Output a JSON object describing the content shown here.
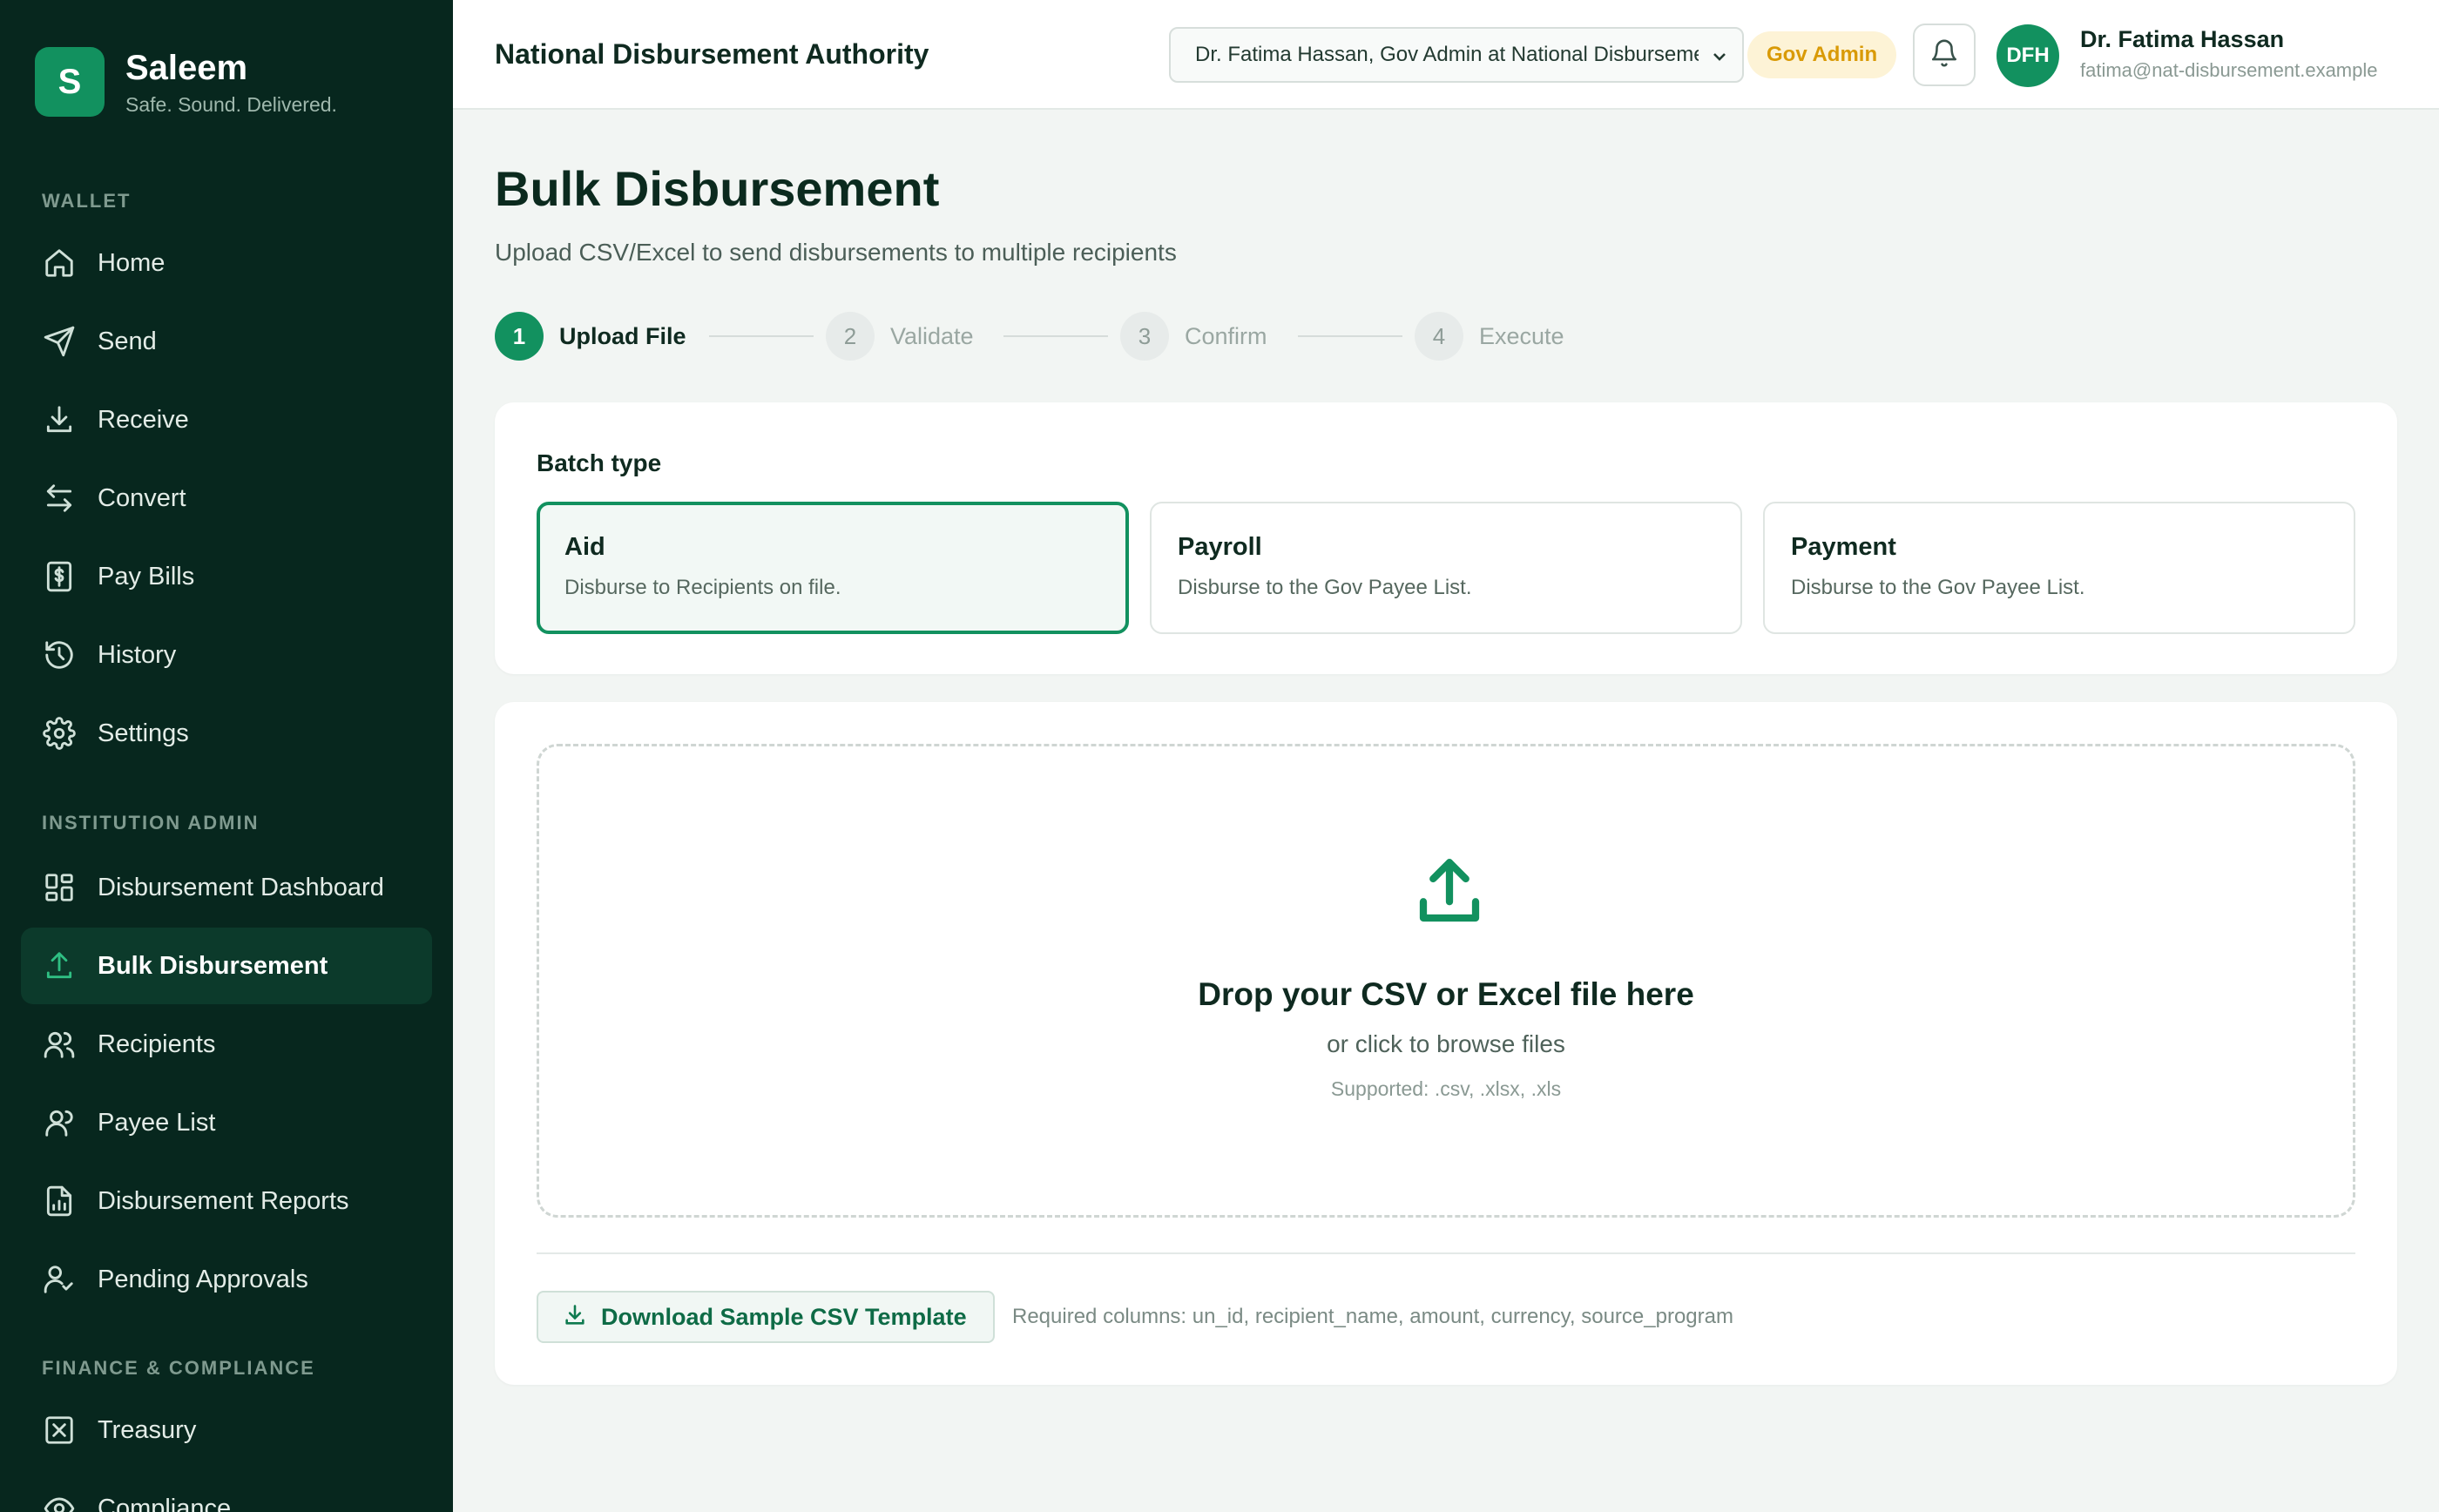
{
  "brand": {
    "initial": "S",
    "name": "Saleem",
    "tagline": "Safe. Sound. Delivered."
  },
  "sidebar": {
    "sections": [
      {
        "label": "WALLET",
        "items": [
          {
            "label": "Home",
            "icon": "home-icon"
          },
          {
            "label": "Send",
            "icon": "send-icon"
          },
          {
            "label": "Receive",
            "icon": "receive-icon"
          },
          {
            "label": "Convert",
            "icon": "convert-icon"
          },
          {
            "label": "Pay Bills",
            "icon": "bill-icon"
          },
          {
            "label": "History",
            "icon": "history-icon"
          },
          {
            "label": "Settings",
            "icon": "gear-icon"
          }
        ]
      },
      {
        "label": "INSTITUTION ADMIN",
        "items": [
          {
            "label": "Disbursement Dashboard",
            "icon": "dashboard-icon"
          },
          {
            "label": "Bulk Disbursement",
            "icon": "upload-icon",
            "active": true
          },
          {
            "label": "Recipients",
            "icon": "users-icon"
          },
          {
            "label": "Payee List",
            "icon": "user-icon"
          },
          {
            "label": "Disbursement Reports",
            "icon": "report-icon"
          },
          {
            "label": "Pending Approvals",
            "icon": "user-check-icon"
          }
        ]
      },
      {
        "label": "FINANCE & COMPLIANCE",
        "items": [
          {
            "label": "Treasury",
            "icon": "treasury-icon"
          },
          {
            "label": "Compliance",
            "icon": "eye-icon"
          }
        ]
      }
    ]
  },
  "topbar": {
    "org_title": "National Disbursement Authority",
    "account_select": "Dr. Fatima Hassan, Gov Admin at National Disbursement Authority",
    "role_badge": "Gov Admin",
    "avatar_initials": "DFH",
    "user_name": "Dr. Fatima Hassan",
    "user_email": "fatima@nat-disbursement.example"
  },
  "page": {
    "title": "Bulk Disbursement",
    "subtitle": "Upload CSV/Excel to send disbursements to multiple recipients"
  },
  "steps": [
    {
      "num": "1",
      "label": "Upload File",
      "active": true
    },
    {
      "num": "2",
      "label": "Validate"
    },
    {
      "num": "3",
      "label": "Confirm"
    },
    {
      "num": "4",
      "label": "Execute"
    }
  ],
  "batch": {
    "label": "Batch type",
    "options": [
      {
        "title": "Aid",
        "desc": "Disburse to Recipients on file.",
        "selected": true
      },
      {
        "title": "Payroll",
        "desc": "Disburse to the Gov Payee List."
      },
      {
        "title": "Payment",
        "desc": "Disburse to the Gov Payee List."
      }
    ]
  },
  "upload": {
    "title": "Drop your CSV or Excel file here",
    "subtitle": "or click to browse files",
    "hint": "Supported: .csv, .xlsx, .xls",
    "download_label": "Download Sample CSV Template",
    "required_columns": "Required columns: un_id, recipient_name, amount, currency, source_program"
  },
  "colors": {
    "sidebar_bg": "#07271e",
    "accent": "#12915f",
    "badge_bg": "#fdf3d6",
    "badge_text": "#d99a06"
  }
}
